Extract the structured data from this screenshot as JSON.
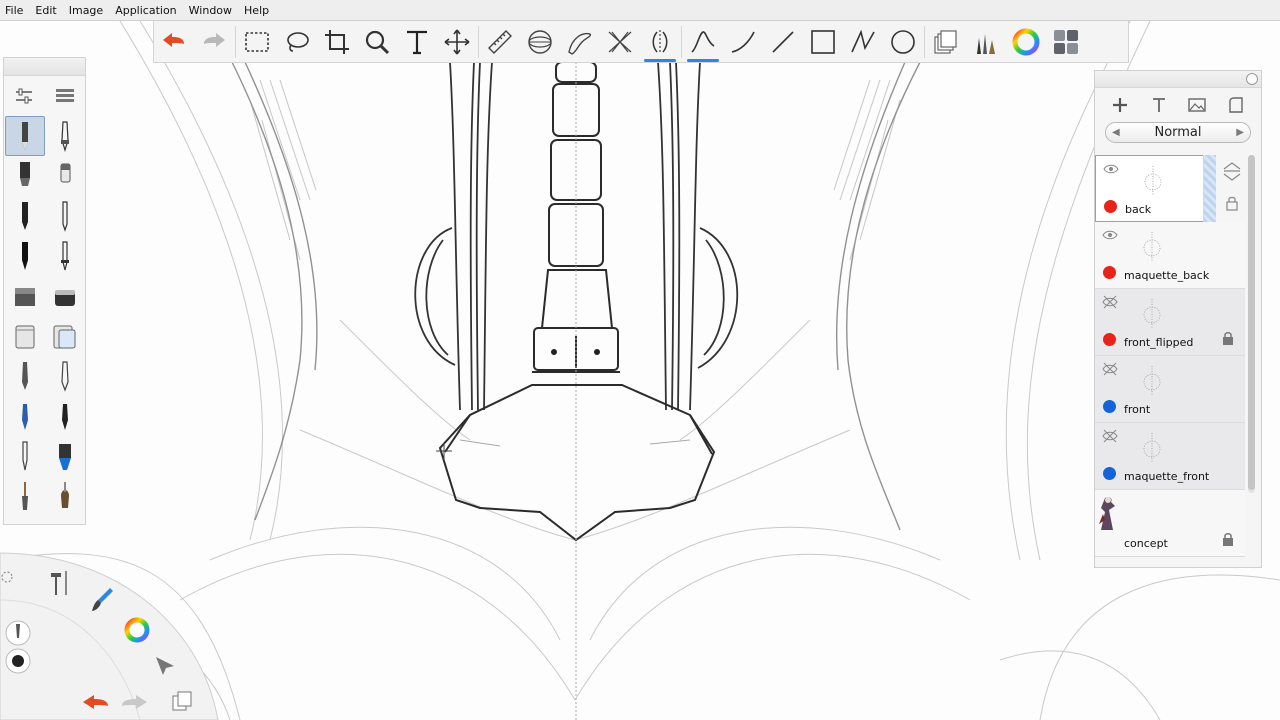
{
  "menu": {
    "items": [
      "File",
      "Edit",
      "Image",
      "Application",
      "Window",
      "Help"
    ]
  },
  "toolbar": {
    "tools": [
      {
        "name": "undo-icon"
      },
      {
        "name": "redo-icon"
      },
      {
        "name": "rectangle-select-icon"
      },
      {
        "name": "lasso-select-icon"
      },
      {
        "name": "crop-icon"
      },
      {
        "name": "zoom-icon"
      },
      {
        "name": "text-icon"
      },
      {
        "name": "transform-icon"
      },
      {
        "name": "ruler-icon"
      },
      {
        "name": "ellipse-guide-icon"
      },
      {
        "name": "french-curve-icon"
      },
      {
        "name": "perspective-icon"
      },
      {
        "name": "symmetry-icon",
        "active": true
      },
      {
        "name": "steady-stroke-icon",
        "active": true
      },
      {
        "name": "curve-icon"
      },
      {
        "name": "line-icon"
      },
      {
        "name": "rectangle-icon"
      },
      {
        "name": "polyline-icon"
      },
      {
        "name": "ellipse-icon"
      },
      {
        "name": "layer-editor-icon"
      },
      {
        "name": "brush-library-icon"
      },
      {
        "name": "color-wheel-icon"
      },
      {
        "name": "copic-library-icon"
      }
    ]
  },
  "brushes": {
    "selected_index": 0,
    "items": [
      "pencil",
      "ballpoint-pen",
      "marker",
      "chisel-marker",
      "fineliner",
      "felt-pen",
      "ink-pen",
      "technical-pen",
      "airbrush",
      "soft-eraser",
      "paint-bucket",
      "fill-bucket",
      "smudge",
      "blend",
      "brush-pen",
      "calligraphy",
      "paint-brush",
      "ink-brush",
      "dry-brush",
      "bristle-brush"
    ]
  },
  "layers": {
    "blend_mode": "Normal",
    "items": [
      {
        "name": "back",
        "color": "#e8231a",
        "visible": true,
        "locked": false,
        "selected": true
      },
      {
        "name": "maquette_back",
        "color": "#e8231a",
        "visible": true,
        "locked": false,
        "selected": false
      },
      {
        "name": "front_flipped",
        "color": "#e8231a",
        "visible": false,
        "locked": true,
        "selected": false
      },
      {
        "name": "front",
        "color": "#1464d8",
        "visible": false,
        "locked": false,
        "selected": false
      },
      {
        "name": "maquette_front",
        "color": "#1464d8",
        "visible": false,
        "locked": false,
        "selected": false
      },
      {
        "name": "concept",
        "color": "",
        "visible": true,
        "locked": true,
        "selected": false
      }
    ]
  },
  "colors": {
    "accent": "#2e86de",
    "undo": "#e44b23",
    "canvas": "#fdfdfd"
  }
}
